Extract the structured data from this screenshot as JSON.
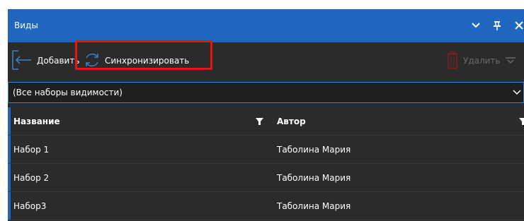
{
  "window": {
    "title": "Виды",
    "icons": [
      "chevron-down-icon",
      "pin-icon",
      "close-icon"
    ]
  },
  "toolbar": {
    "add_label": "Добавить",
    "add_icon": "add-panel-icon",
    "sync_label": "Синхронизировать",
    "sync_icon": "sync-icon",
    "delete_label": "Удалить",
    "delete_icon": "trash-icon",
    "delete_enabled": false
  },
  "filter": {
    "selected": "(Все наборы видимости)"
  },
  "table": {
    "columns": [
      "Название",
      "Автор"
    ],
    "rows": [
      [
        "Набор 1",
        "Таболина Мария"
      ],
      [
        "Набор 2",
        "Таболина Мария"
      ],
      [
        "Набор3",
        "Таболина Мария"
      ]
    ]
  },
  "colors": {
    "titlebar": "#1e66c0",
    "panel": "#2b2b2b",
    "highlight": "#e01515",
    "accent_border": "#3a83c9"
  }
}
